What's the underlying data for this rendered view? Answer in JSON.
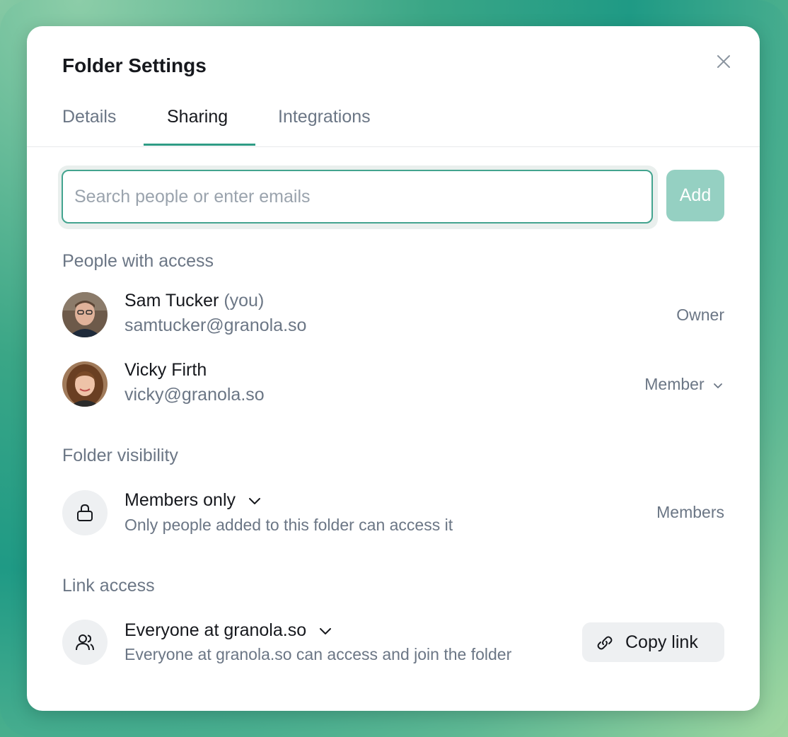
{
  "dialog": {
    "title": "Folder Settings"
  },
  "tabs": [
    {
      "label": "Details",
      "active": false
    },
    {
      "label": "Sharing",
      "active": true
    },
    {
      "label": "Integrations",
      "active": false
    }
  ],
  "search": {
    "placeholder": "Search people or enter emails",
    "value": ""
  },
  "add_button": {
    "label": "Add"
  },
  "people_section": {
    "heading": "People with access",
    "people": [
      {
        "name": "Sam Tucker",
        "you_tag": "(you)",
        "email": "samtucker@granola.so",
        "role": "Owner",
        "role_editable": false
      },
      {
        "name": "Vicky Firth",
        "you_tag": "",
        "email": "vicky@granola.so",
        "role": "Member",
        "role_editable": true
      }
    ]
  },
  "visibility_section": {
    "heading": "Folder visibility",
    "option": "Members only",
    "description": "Only people added to this folder can access it",
    "status": "Members"
  },
  "link_section": {
    "heading": "Link access",
    "option": "Everyone at granola.so",
    "description": "Everyone at granola.so can access and join the folder",
    "copy_label": "Copy link"
  },
  "colors": {
    "accent": "#2f9c85",
    "add_button_bg": "#95d0c2",
    "muted_text": "#6b7685",
    "primary_text": "#16181d"
  },
  "icons": [
    "close-icon",
    "chevron-down-icon",
    "lock-icon",
    "users-icon",
    "link-icon"
  ]
}
